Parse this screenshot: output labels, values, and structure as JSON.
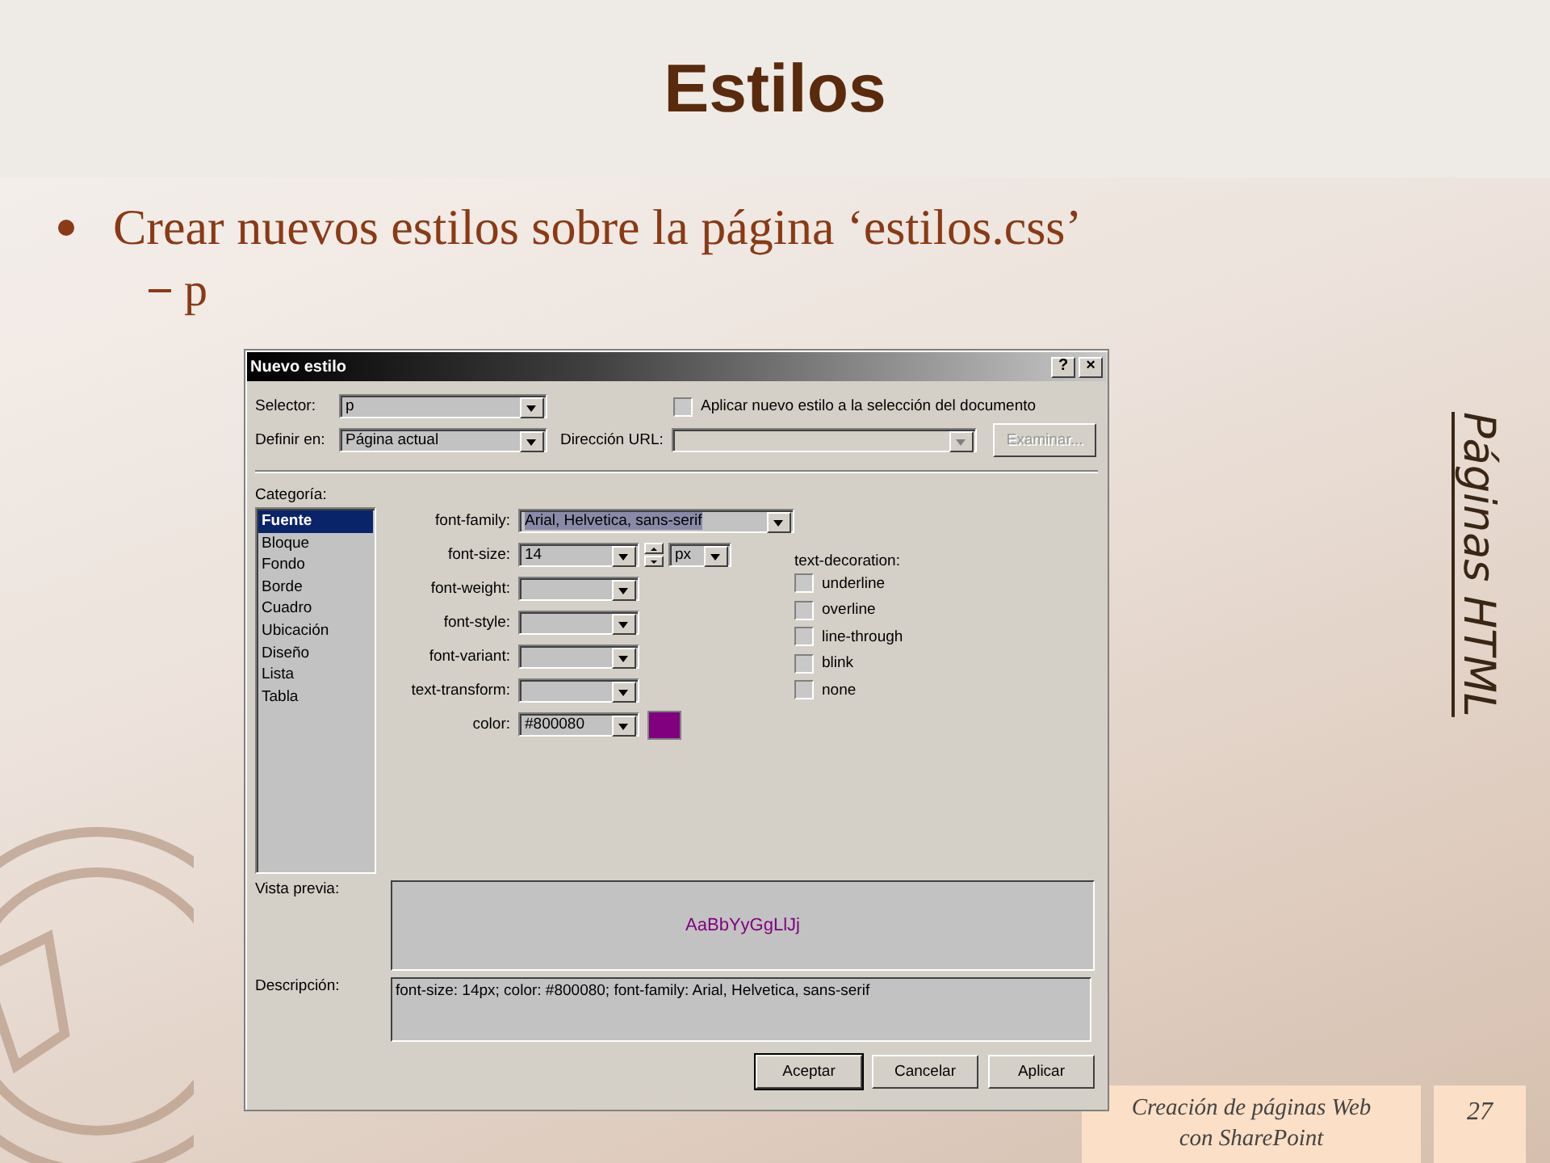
{
  "slide": {
    "title": "Estilos",
    "bullets": [
      {
        "text": "Crear nuevos estilos sobre la página ‘estilos.css’",
        "children": [
          {
            "text": "p"
          }
        ]
      }
    ],
    "side_label": "Páginas HTML",
    "footer": {
      "lines": [
        "Creación de páginas Web",
        "con SharePoint"
      ],
      "page": "27"
    }
  },
  "dialog": {
    "title": "Nuevo estilo",
    "help": "?",
    "close": "×",
    "selector": {
      "label": "Selector:",
      "value": "p"
    },
    "apply_checkbox": {
      "label": "Aplicar nuevo estilo a la selección del documento",
      "checked": false
    },
    "define_in": {
      "label": "Definir en:",
      "value": "Página actual"
    },
    "url": {
      "label": "Dirección URL:",
      "disabled": true
    },
    "browse_button": {
      "label": "Examinar...",
      "disabled": true
    },
    "category_label": "Categoría:",
    "categories": [
      {
        "label": "Fuente",
        "selected": true
      },
      {
        "label": "Bloque",
        "selected": false
      },
      {
        "label": "Fondo",
        "selected": false
      },
      {
        "label": "Borde",
        "selected": false
      },
      {
        "label": "Cuadro",
        "selected": false
      },
      {
        "label": "Ubicación",
        "selected": false
      },
      {
        "label": "Diseño",
        "selected": false
      },
      {
        "label": "Lista",
        "selected": false
      },
      {
        "label": "Tabla",
        "selected": false
      }
    ],
    "fields": [
      {
        "kind": "wide",
        "label": "font-family:",
        "value": "Arial, Helvetica, sans-serif"
      },
      {
        "kind": "size",
        "label": "font-size:",
        "value": "14",
        "unit": "px"
      },
      {
        "kind": "plain",
        "label": "font-weight:"
      },
      {
        "kind": "plain",
        "label": "font-style:"
      },
      {
        "kind": "plain",
        "label": "font-variant:"
      },
      {
        "kind": "plain",
        "label": "text-transform:"
      },
      {
        "kind": "color",
        "label": "color:",
        "value": "#800080",
        "color": "#800080"
      }
    ],
    "text_decoration": {
      "label": "text-decoration:",
      "options": [
        {
          "label": "underline",
          "checked": false
        },
        {
          "label": "overline",
          "checked": false
        },
        {
          "label": "line-through",
          "checked": false
        },
        {
          "label": "blink",
          "checked": false
        },
        {
          "label": "none",
          "checked": false
        }
      ]
    },
    "preview": {
      "label": "Vista previa:",
      "text": "AaBbYyGgLlJj"
    },
    "description": {
      "label": "Descripción:",
      "text": "font-size: 14px; color: #800080; font-family: Arial, Helvetica, sans-serif"
    },
    "buttons": [
      {
        "label": "Aceptar",
        "default": true
      },
      {
        "label": "Cancelar",
        "default": false
      },
      {
        "label": "Aplicar",
        "default": false
      }
    ]
  }
}
